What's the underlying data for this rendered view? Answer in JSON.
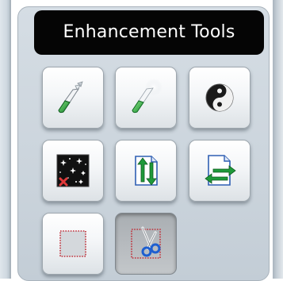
{
  "panel": {
    "title": "Enhancement Tools"
  },
  "tools": [
    {
      "name": "brush-tool",
      "icon": "green-brush-icon",
      "state": "normal"
    },
    {
      "name": "soft-brush-tool",
      "icon": "green-soft-brush-icon",
      "state": "normal"
    },
    {
      "name": "yin-yang-tool",
      "icon": "yin-yang-icon",
      "state": "normal"
    },
    {
      "name": "noise-tool",
      "icon": "sparkle-noise-icon",
      "state": "normal"
    },
    {
      "name": "flip-vertical-tool",
      "icon": "flip-vertical-icon",
      "state": "normal"
    },
    {
      "name": "flip-horizontal-tool",
      "icon": "flip-horizontal-icon",
      "state": "normal"
    },
    {
      "name": "select-frame-tool",
      "icon": "dotted-frame-icon",
      "state": "normal"
    },
    {
      "name": "crop-tool",
      "icon": "scissors-frame-icon",
      "state": "pressed"
    }
  ],
  "colors": {
    "title_bg": "#050505",
    "title_text": "#ffffff",
    "panel_bg": "#cbd4dc",
    "accent_green": "#1f9a3a",
    "accent_blue": "#1e5fd0",
    "accent_red": "#c0303a"
  }
}
